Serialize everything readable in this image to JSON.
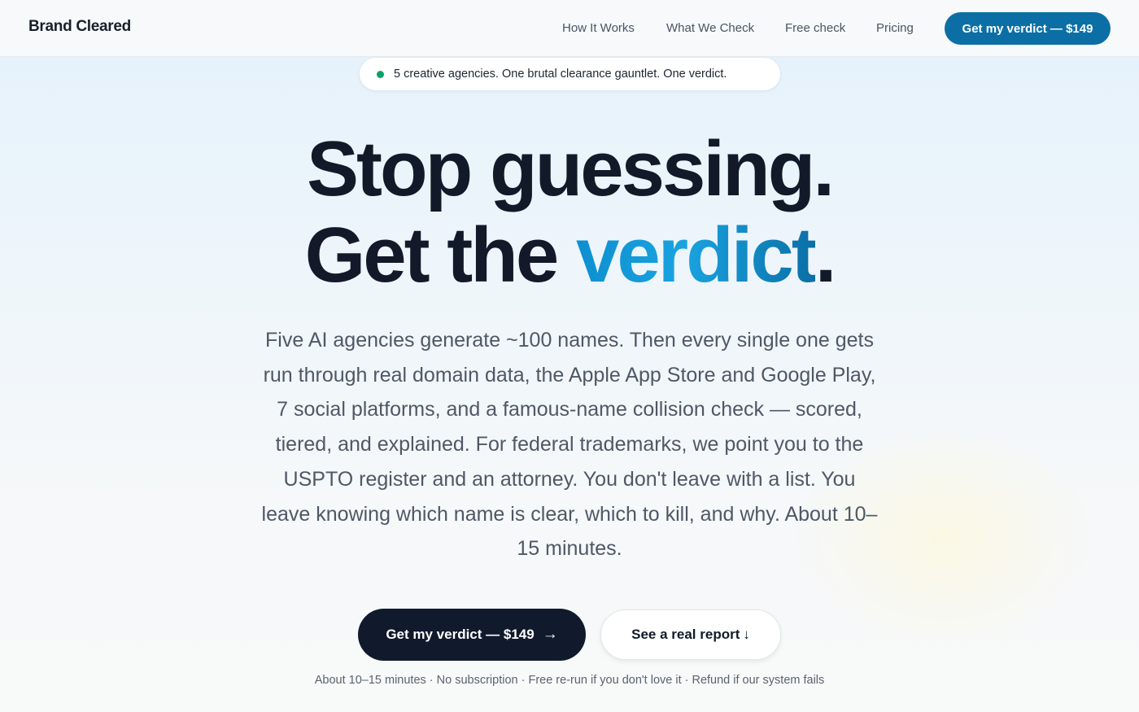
{
  "nav": {
    "brand": "Brand Cleared",
    "links": [
      "How It Works",
      "What We Check",
      "Free check",
      "Pricing"
    ],
    "cta": "Get my verdict — $149"
  },
  "pill": {
    "text": "5 creative agencies. One brutal clearance gauntlet. One verdict.",
    "dot_color": "#10a06a"
  },
  "hero": {
    "line1": "Stop guessing.",
    "line2_prefix": "Get the ",
    "line2_accent": "verdict",
    "line2_suffix": ".",
    "subhead": "Five AI agencies generate ~100 names. Then every single one gets run through real domain data, the Apple App Store and Google Play, 7 social platforms, and a famous-name collision check — scored, tiered, and explained. For federal trademarks, we point you to the USPTO register and an attorney. You don't leave with a list. You leave knowing which name is clear, which to kill, and why. About 10–15 minutes."
  },
  "actions": {
    "primary_label": "Get my verdict — $149",
    "primary_arrow": "→",
    "secondary_label": "See a real report",
    "secondary_arrow": "↓"
  },
  "fineprint": "About 10–15 minutes · No subscription · Free re-run if you don't love it · Refund if our system fails",
  "colors": {
    "accent": "#0b6fa6",
    "dark": "#101a2c",
    "status_green": "#10a06a"
  }
}
